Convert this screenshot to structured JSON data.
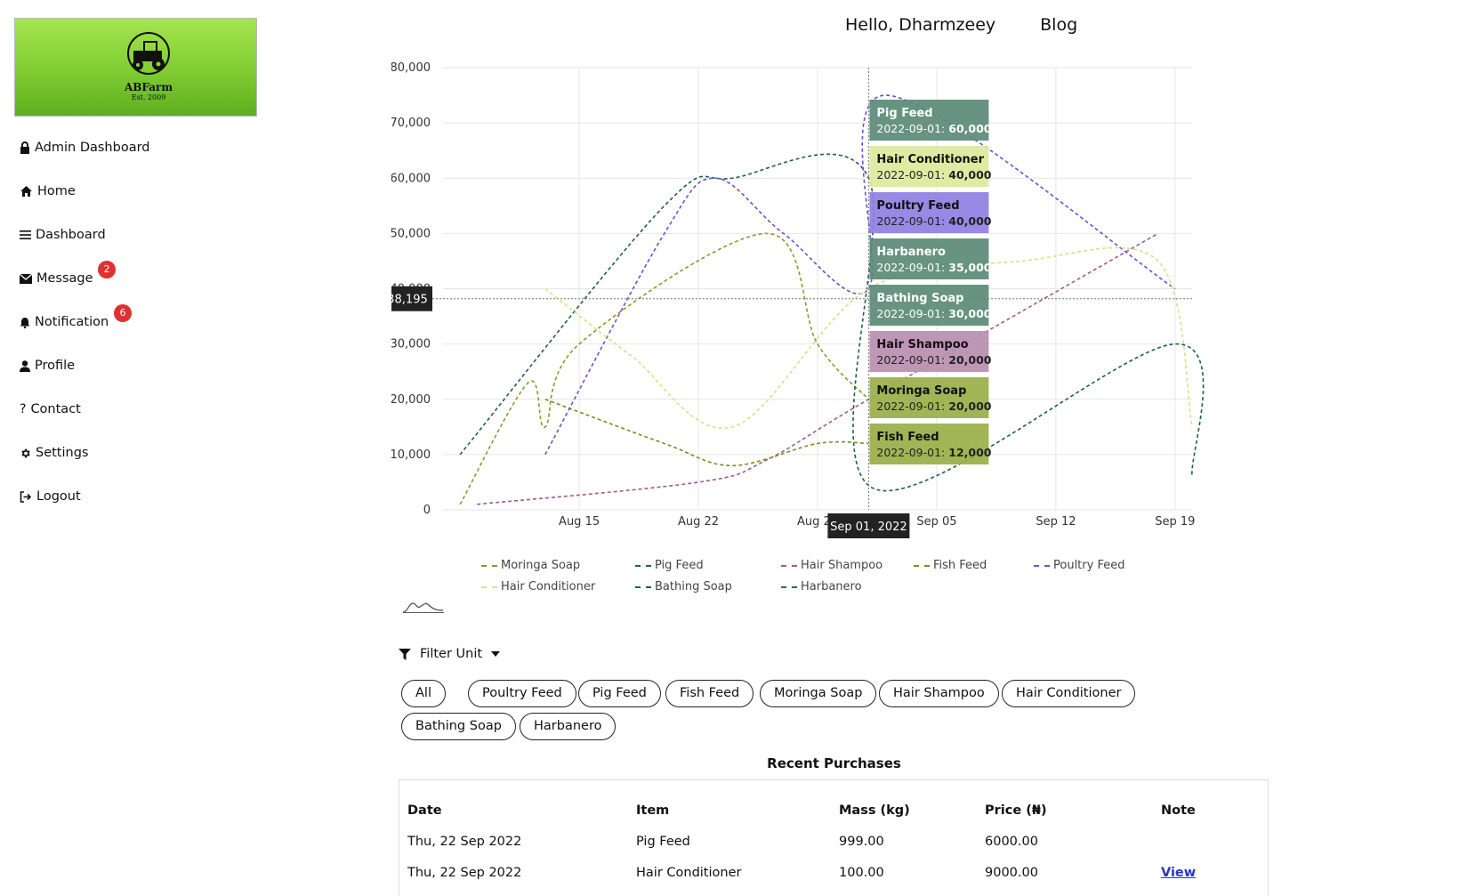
{
  "brand": {
    "name": "ABFarm",
    "established": "Est. 2009"
  },
  "sidebar": {
    "items": [
      {
        "label": "Admin Dashboard",
        "icon": "lock-icon"
      },
      {
        "label": "Home",
        "icon": "home-icon"
      },
      {
        "label": "Dashboard",
        "icon": "menu-icon"
      },
      {
        "label": "Message",
        "icon": "envelope-icon",
        "badge": "2"
      },
      {
        "label": "Notification",
        "icon": "bell-icon",
        "badge": "6"
      },
      {
        "label": "Profile",
        "icon": "user-icon"
      },
      {
        "label": "Contact",
        "icon": "question-icon"
      },
      {
        "label": "Settings",
        "icon": "gear-icon"
      },
      {
        "label": "Logout",
        "icon": "logout-icon"
      }
    ]
  },
  "header": {
    "greeting": "Hello, Dharmzeey",
    "blog": "Blog"
  },
  "chart_data": {
    "type": "line",
    "ylim": [
      0,
      80000
    ],
    "y_ticks": [
      "0",
      "10,000",
      "20,000",
      "30,000",
      "40,000",
      "50,000",
      "60,000",
      "70,000",
      "80,000"
    ],
    "x_ticks": [
      "Aug 15",
      "Aug 22",
      "Aug 29",
      "Sep 05",
      "Sep 12",
      "Sep 19"
    ],
    "grid": true,
    "legend_position": "bottom",
    "crosshair": {
      "y_label": "38,195",
      "x_label": "Sep 01, 2022"
    },
    "series": [
      {
        "name": "Moringa Soap",
        "color": "#8a9a2b",
        "points": [
          [
            8,
            1000
          ],
          [
            12,
            23000
          ],
          [
            13,
            15000
          ],
          [
            15,
            30000
          ],
          [
            26,
            50000
          ],
          [
            29,
            30000
          ],
          [
            32,
            20000
          ]
        ]
      },
      {
        "name": "Pig Feed",
        "color": "#1f5f4b",
        "points": [
          [
            8,
            10000
          ],
          [
            20,
            55000
          ],
          [
            24,
            60000
          ],
          [
            32,
            60000
          ],
          [
            32.2,
            4000
          ],
          [
            50,
            30000
          ],
          [
            51,
            6000
          ]
        ]
      },
      {
        "name": "Hair Shampoo",
        "color": "#a05a93",
        "points": [
          [
            9,
            1000
          ],
          [
            22,
            5000
          ],
          [
            26,
            9000
          ],
          [
            32,
            20000
          ],
          [
            49,
            50000
          ]
        ]
      },
      {
        "name": "Fish Feed",
        "color": "#7c8c1f",
        "points": [
          [
            13,
            20000
          ],
          [
            20,
            12000
          ],
          [
            24,
            8000
          ],
          [
            29,
            12000
          ],
          [
            32,
            12000
          ]
        ]
      },
      {
        "name": "Poultry Feed",
        "color": "#6a50d6",
        "points": [
          [
            13,
            10000
          ],
          [
            20,
            50000
          ],
          [
            23,
            60000
          ],
          [
            27,
            50000
          ],
          [
            32,
            40000
          ],
          [
            33,
            75000
          ],
          [
            50,
            40000
          ]
        ]
      },
      {
        "name": "Hair Conditioner",
        "color": "#d4e38a",
        "points": [
          [
            13,
            40000
          ],
          [
            18,
            28000
          ],
          [
            24,
            15000
          ],
          [
            32,
            40000
          ],
          [
            41,
            45000
          ],
          [
            49,
            45000
          ],
          [
            51,
            15000
          ]
        ]
      },
      {
        "name": "Bathing Soap",
        "color": "#1f5f4b",
        "points": []
      },
      {
        "name": "Harbanero",
        "color": "#2d6a5a",
        "points": []
      }
    ],
    "tooltips": [
      {
        "name": "Pig Feed",
        "date": "2022-09-01",
        "value": "60,000",
        "color": "#5b8a78"
      },
      {
        "name": "Hair Conditioner",
        "date": "2022-09-01",
        "value": "40,000",
        "color": "#dce99a"
      },
      {
        "name": "Poultry Feed",
        "date": "2022-09-01",
        "value": "40,000",
        "color": "#8e7fe2"
      },
      {
        "name": "Harbanero",
        "date": "2022-09-01",
        "value": "35,000",
        "color": "#5b8a78"
      },
      {
        "name": "Bathing Soap",
        "date": "2022-09-01",
        "value": "30,000",
        "color": "#5b8a78"
      },
      {
        "name": "Hair Shampoo",
        "date": "2022-09-01",
        "value": "20,000",
        "color": "#b98db0"
      },
      {
        "name": "Moringa Soap",
        "date": "2022-09-01",
        "value": "20,000",
        "color": "#9bae48"
      },
      {
        "name": "Fish Feed",
        "date": "2022-09-01",
        "value": "12,000",
        "color": "#9bae48"
      }
    ]
  },
  "filter": {
    "label": "Filter Unit"
  },
  "chips": [
    "All",
    "Poultry Feed",
    "Pig Feed",
    "Fish Feed",
    "Moringa Soap",
    "Hair Shampoo",
    "Hair Conditioner",
    "Bathing Soap",
    "Harbanero"
  ],
  "purchases": {
    "title": "Recent Purchases",
    "columns": [
      "Date",
      "Item",
      "Mass (kg)",
      "Price (₦)",
      "Note"
    ],
    "rows": [
      [
        "Thu, 22 Sep 2022",
        "Pig Feed",
        "999.00",
        "6000.00",
        ""
      ],
      [
        "Thu, 22 Sep 2022",
        "Hair Conditioner",
        "100.00",
        "9000.00",
        "View"
      ]
    ]
  }
}
